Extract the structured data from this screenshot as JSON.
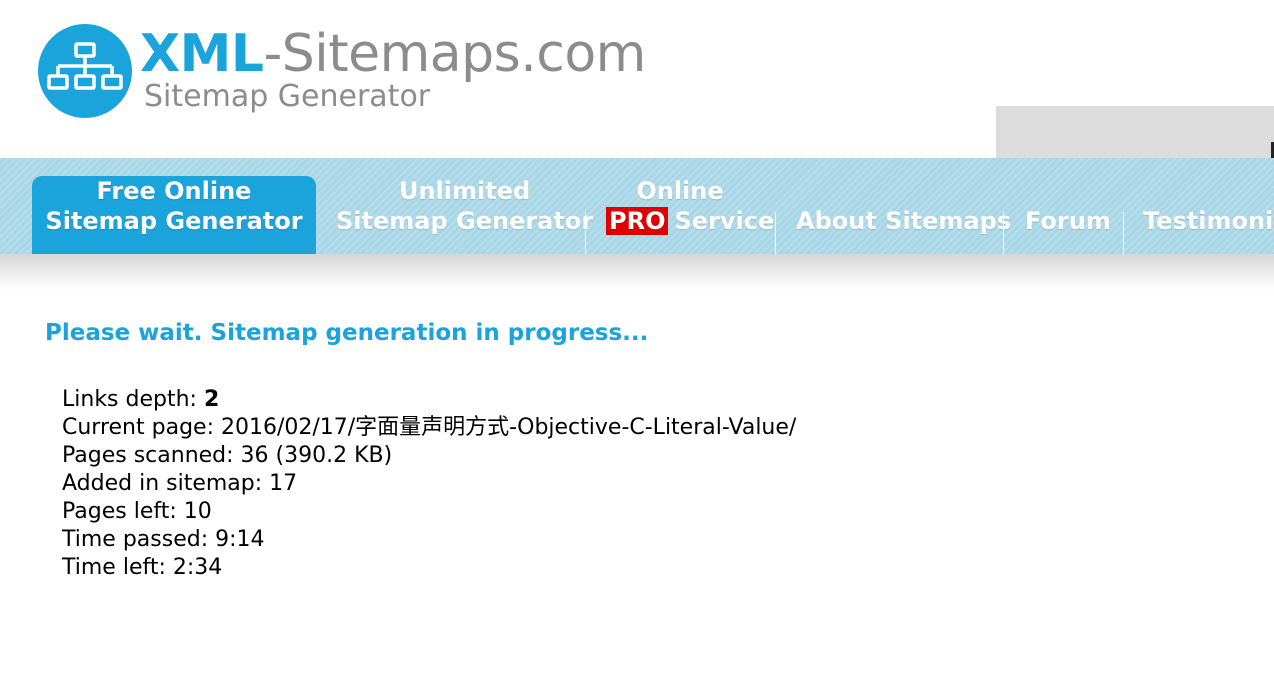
{
  "logo": {
    "title_bold": "XML",
    "title_rest": "-Sitemaps.com",
    "subtitle": "Sitemap Generator",
    "icon": "sitemap-tree-icon"
  },
  "nav": {
    "items": [
      {
        "line1": "Free Online",
        "line2": "Sitemap Generator",
        "active": true
      },
      {
        "line1": "Unlimited",
        "line2": "Sitemap Generator",
        "active": false
      },
      {
        "line1": "Online",
        "badge": "PRO",
        "line2": "Service",
        "active": false
      },
      {
        "line1": "",
        "line2": "About Sitemaps",
        "active": false
      },
      {
        "line1": "",
        "line2": "Forum",
        "active": false
      },
      {
        "line1": "",
        "line2": "Testimonia",
        "active": false
      }
    ]
  },
  "status": {
    "heading": "Please wait. Sitemap generation in progress...",
    "links_depth_label": "Links depth: ",
    "links_depth_value": "2",
    "current_page": "Current page: 2016/02/17/字面量声明方式-Objective-C-Literal-Value/",
    "pages_scanned": "Pages scanned: 36 (390.2 KB)",
    "added_in_sitemap": "Added in sitemap: 17",
    "pages_left": "Pages left: 10",
    "time_passed": "Time passed: 9:14",
    "time_left": "Time left: 2:34"
  },
  "colors": {
    "brand_blue": "#1ba3dc",
    "nav_bg": "#a8d6e6",
    "pro_red": "#e00000",
    "logo_gray": "#8c8c8c"
  }
}
